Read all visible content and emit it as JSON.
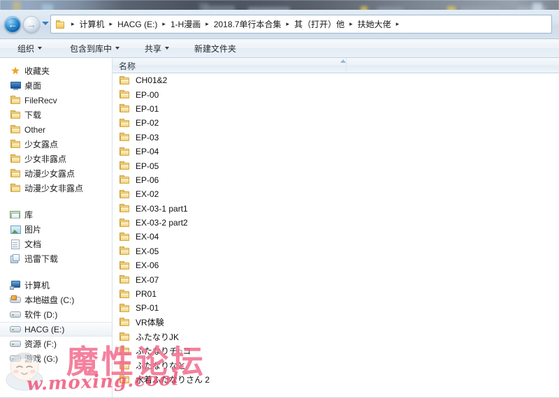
{
  "window": {
    "nav": {
      "back_icon": "back-arrow-icon",
      "back_glyph": "←",
      "forward_icon": "forward-arrow-icon",
      "forward_glyph": "→",
      "history_icon": "chevron-down-icon"
    },
    "breadcrumb": {
      "folder_icon": "folder-icon",
      "separator": "▸",
      "items": [
        "计算机",
        "HACG (E:)",
        "1-H漫画",
        "2018.7单行本合集",
        "其（打开）他",
        "扶她大佬"
      ]
    }
  },
  "toolbar": {
    "items": [
      {
        "label": "组织",
        "has_caret": true,
        "name": "organize-button"
      },
      {
        "label": "包含到库中",
        "has_caret": true,
        "name": "include-in-library-button"
      },
      {
        "label": "共享",
        "has_caret": true,
        "name": "share-with-button"
      },
      {
        "label": "新建文件夹",
        "has_caret": false,
        "name": "new-folder-button"
      }
    ]
  },
  "nav_pane": {
    "favorites": {
      "label": "收藏夹",
      "icon": "star-icon",
      "star_glyph": "★",
      "items": [
        {
          "label": "桌面",
          "icon": "desktop-icon"
        },
        {
          "label": "FileRecv",
          "icon": "folder-icon"
        },
        {
          "label": "下载",
          "icon": "downloads-icon"
        },
        {
          "label": "Other",
          "icon": "folder-icon"
        },
        {
          "label": "少女露点",
          "icon": "folder-icon"
        },
        {
          "label": "少女非露点",
          "icon": "folder-icon"
        },
        {
          "label": "动漫少女露点",
          "icon": "folder-icon"
        },
        {
          "label": "动漫少女非露点",
          "icon": "folder-icon"
        }
      ]
    },
    "libraries": {
      "label": "库",
      "icon": "library-icon",
      "items": [
        {
          "label": "图片",
          "icon": "pictures-icon"
        },
        {
          "label": "文档",
          "icon": "documents-icon"
        },
        {
          "label": "迅雷下载",
          "icon": "thunder-download-icon"
        }
      ]
    },
    "computer": {
      "label": "计算机",
      "icon": "computer-icon",
      "items": [
        {
          "label": "本地磁盘 (C:)",
          "icon": "system-drive-icon",
          "selected": false
        },
        {
          "label": "软件 (D:)",
          "icon": "drive-icon",
          "selected": false
        },
        {
          "label": "HACG (E:)",
          "icon": "drive-icon",
          "selected": true
        },
        {
          "label": "资源 (F:)",
          "icon": "drive-icon",
          "selected": false
        },
        {
          "label": "游戏 (G:)",
          "icon": "drive-icon",
          "selected": false
        }
      ]
    }
  },
  "list_pane": {
    "column_header": "名称",
    "sort_indicator": "sort-ascending-icon",
    "files": [
      {
        "name": "CH01&2",
        "icon": "folder-icon"
      },
      {
        "name": "EP-00",
        "icon": "folder-icon"
      },
      {
        "name": "EP-01",
        "icon": "folder-icon"
      },
      {
        "name": "EP-02",
        "icon": "folder-icon"
      },
      {
        "name": "EP-03",
        "icon": "folder-icon"
      },
      {
        "name": "EP-04",
        "icon": "folder-icon"
      },
      {
        "name": "EP-05",
        "icon": "folder-icon"
      },
      {
        "name": "EP-06",
        "icon": "folder-icon"
      },
      {
        "name": "EX-02",
        "icon": "folder-icon"
      },
      {
        "name": "EX-03-1 part1",
        "icon": "folder-icon"
      },
      {
        "name": "EX-03-2 part2",
        "icon": "folder-icon"
      },
      {
        "name": "EX-04",
        "icon": "folder-icon"
      },
      {
        "name": "EX-05",
        "icon": "folder-icon"
      },
      {
        "name": "EX-06",
        "icon": "folder-icon"
      },
      {
        "name": "EX-07",
        "icon": "folder-icon"
      },
      {
        "name": "PR01",
        "icon": "folder-icon"
      },
      {
        "name": "SP-01",
        "icon": "folder-icon"
      },
      {
        "name": "VR体験",
        "icon": "folder-icon"
      },
      {
        "name": "ふたなりJK",
        "icon": "folder-icon"
      },
      {
        "name": "ふたなりチ○コ",
        "icon": "folder-icon"
      },
      {
        "name": "ふたなりなと",
        "icon": "folder-icon"
      },
      {
        "name": "水着ふたなりさん 2",
        "icon": "folder-icon"
      }
    ]
  },
  "watermark": {
    "text": "魔性论坛",
    "url": "w.moxing.cool",
    "mascot": "mascot-icon",
    "color": "#f05078"
  }
}
